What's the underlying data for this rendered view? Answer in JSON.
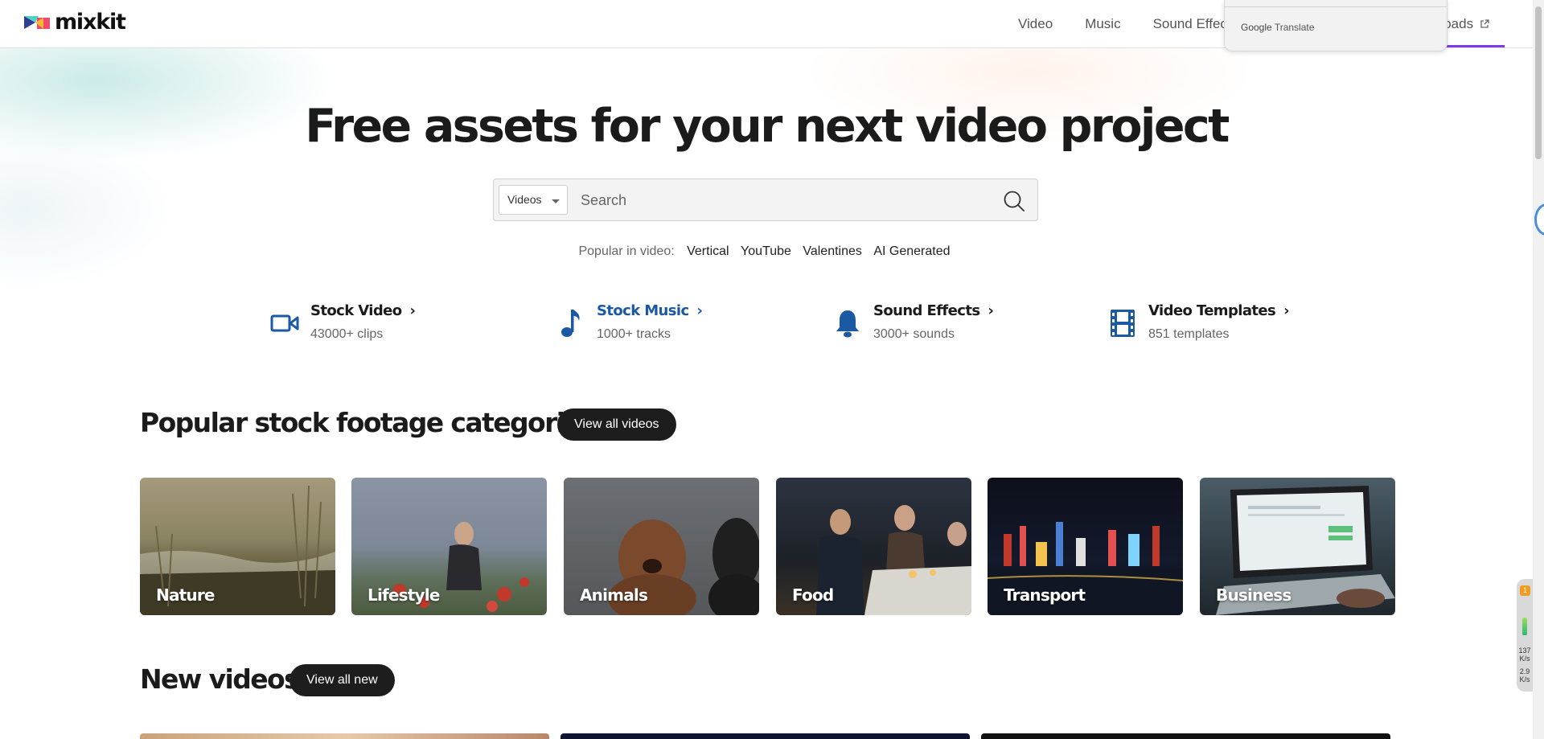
{
  "header": {
    "logo_text": "mixkit",
    "nav": [
      "Video",
      "Music",
      "Sound Effect"
    ],
    "downloads_label": "nloads"
  },
  "translate_popup": {
    "brand": "Google",
    "label": "Translate"
  },
  "hero": {
    "title": "Free assets for your next video project",
    "search": {
      "category": "Videos",
      "placeholder": "Search"
    },
    "popular_label": "Popular in video:",
    "popular_tags": [
      "Vertical",
      "YouTube",
      "Valentines",
      "AI Generated"
    ]
  },
  "categories": [
    {
      "icon": "video-camera-icon",
      "title": "Stock Video",
      "subtitle": "43000+ clips"
    },
    {
      "icon": "music-note-icon",
      "title": "Stock Music",
      "subtitle": "1000+ tracks"
    },
    {
      "icon": "bell-icon",
      "title": "Sound Effects",
      "subtitle": "3000+ sounds"
    },
    {
      "icon": "film-strip-icon",
      "title": "Video Templates",
      "subtitle": "851 templates"
    }
  ],
  "popular_section": {
    "title": "Popular stock footage categories",
    "button": "View all videos",
    "cards": [
      "Nature",
      "Lifestyle",
      "Animals",
      "Food",
      "Transport",
      "Business"
    ]
  },
  "new_section": {
    "title": "New videos",
    "button": "View all new"
  },
  "speed_widget": {
    "badge": "1",
    "down": "137",
    "down_unit": "K/s",
    "up": "2.9",
    "up_unit": "K/s"
  },
  "colors": {
    "accent": "#1b5aa3",
    "nav_underline": "#7c3aed",
    "pill": "#1d1d1d"
  }
}
